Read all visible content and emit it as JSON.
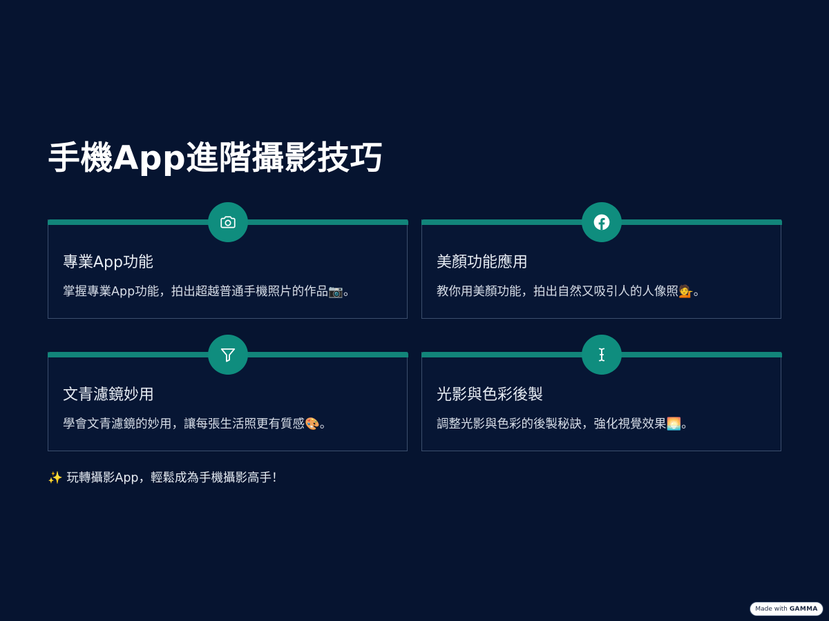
{
  "page": {
    "title": "手機App進階攝影技巧"
  },
  "cards": [
    {
      "icon": "camera-icon",
      "title": "專業App功能",
      "desc": "掌握專業App功能，拍出超越普通手機照片的作品📷。"
    },
    {
      "icon": "facebook-icon",
      "title": "美顏功能應用",
      "desc": "教你用美顏功能，拍出自然又吸引人的人像照💁。"
    },
    {
      "icon": "filter-icon",
      "title": "文青濾鏡妙用",
      "desc": "學會文青濾鏡的妙用，讓每張生活照更有質感🎨。"
    },
    {
      "icon": "text-cursor-icon",
      "title": "光影與色彩後製",
      "desc": "調整光影與色彩的後製秘訣，強化視覺效果🌅。"
    }
  ],
  "footer": {
    "note": "✨ 玩轉攝影App，輕鬆成為手機攝影高手！"
  },
  "badge": {
    "prefix": "Made with",
    "brand": "GAMMA"
  },
  "colors": {
    "background": "#061430",
    "accent": "#12857a",
    "icon_circle": "#0f8d7e",
    "card_border": "#3b4e6d"
  }
}
